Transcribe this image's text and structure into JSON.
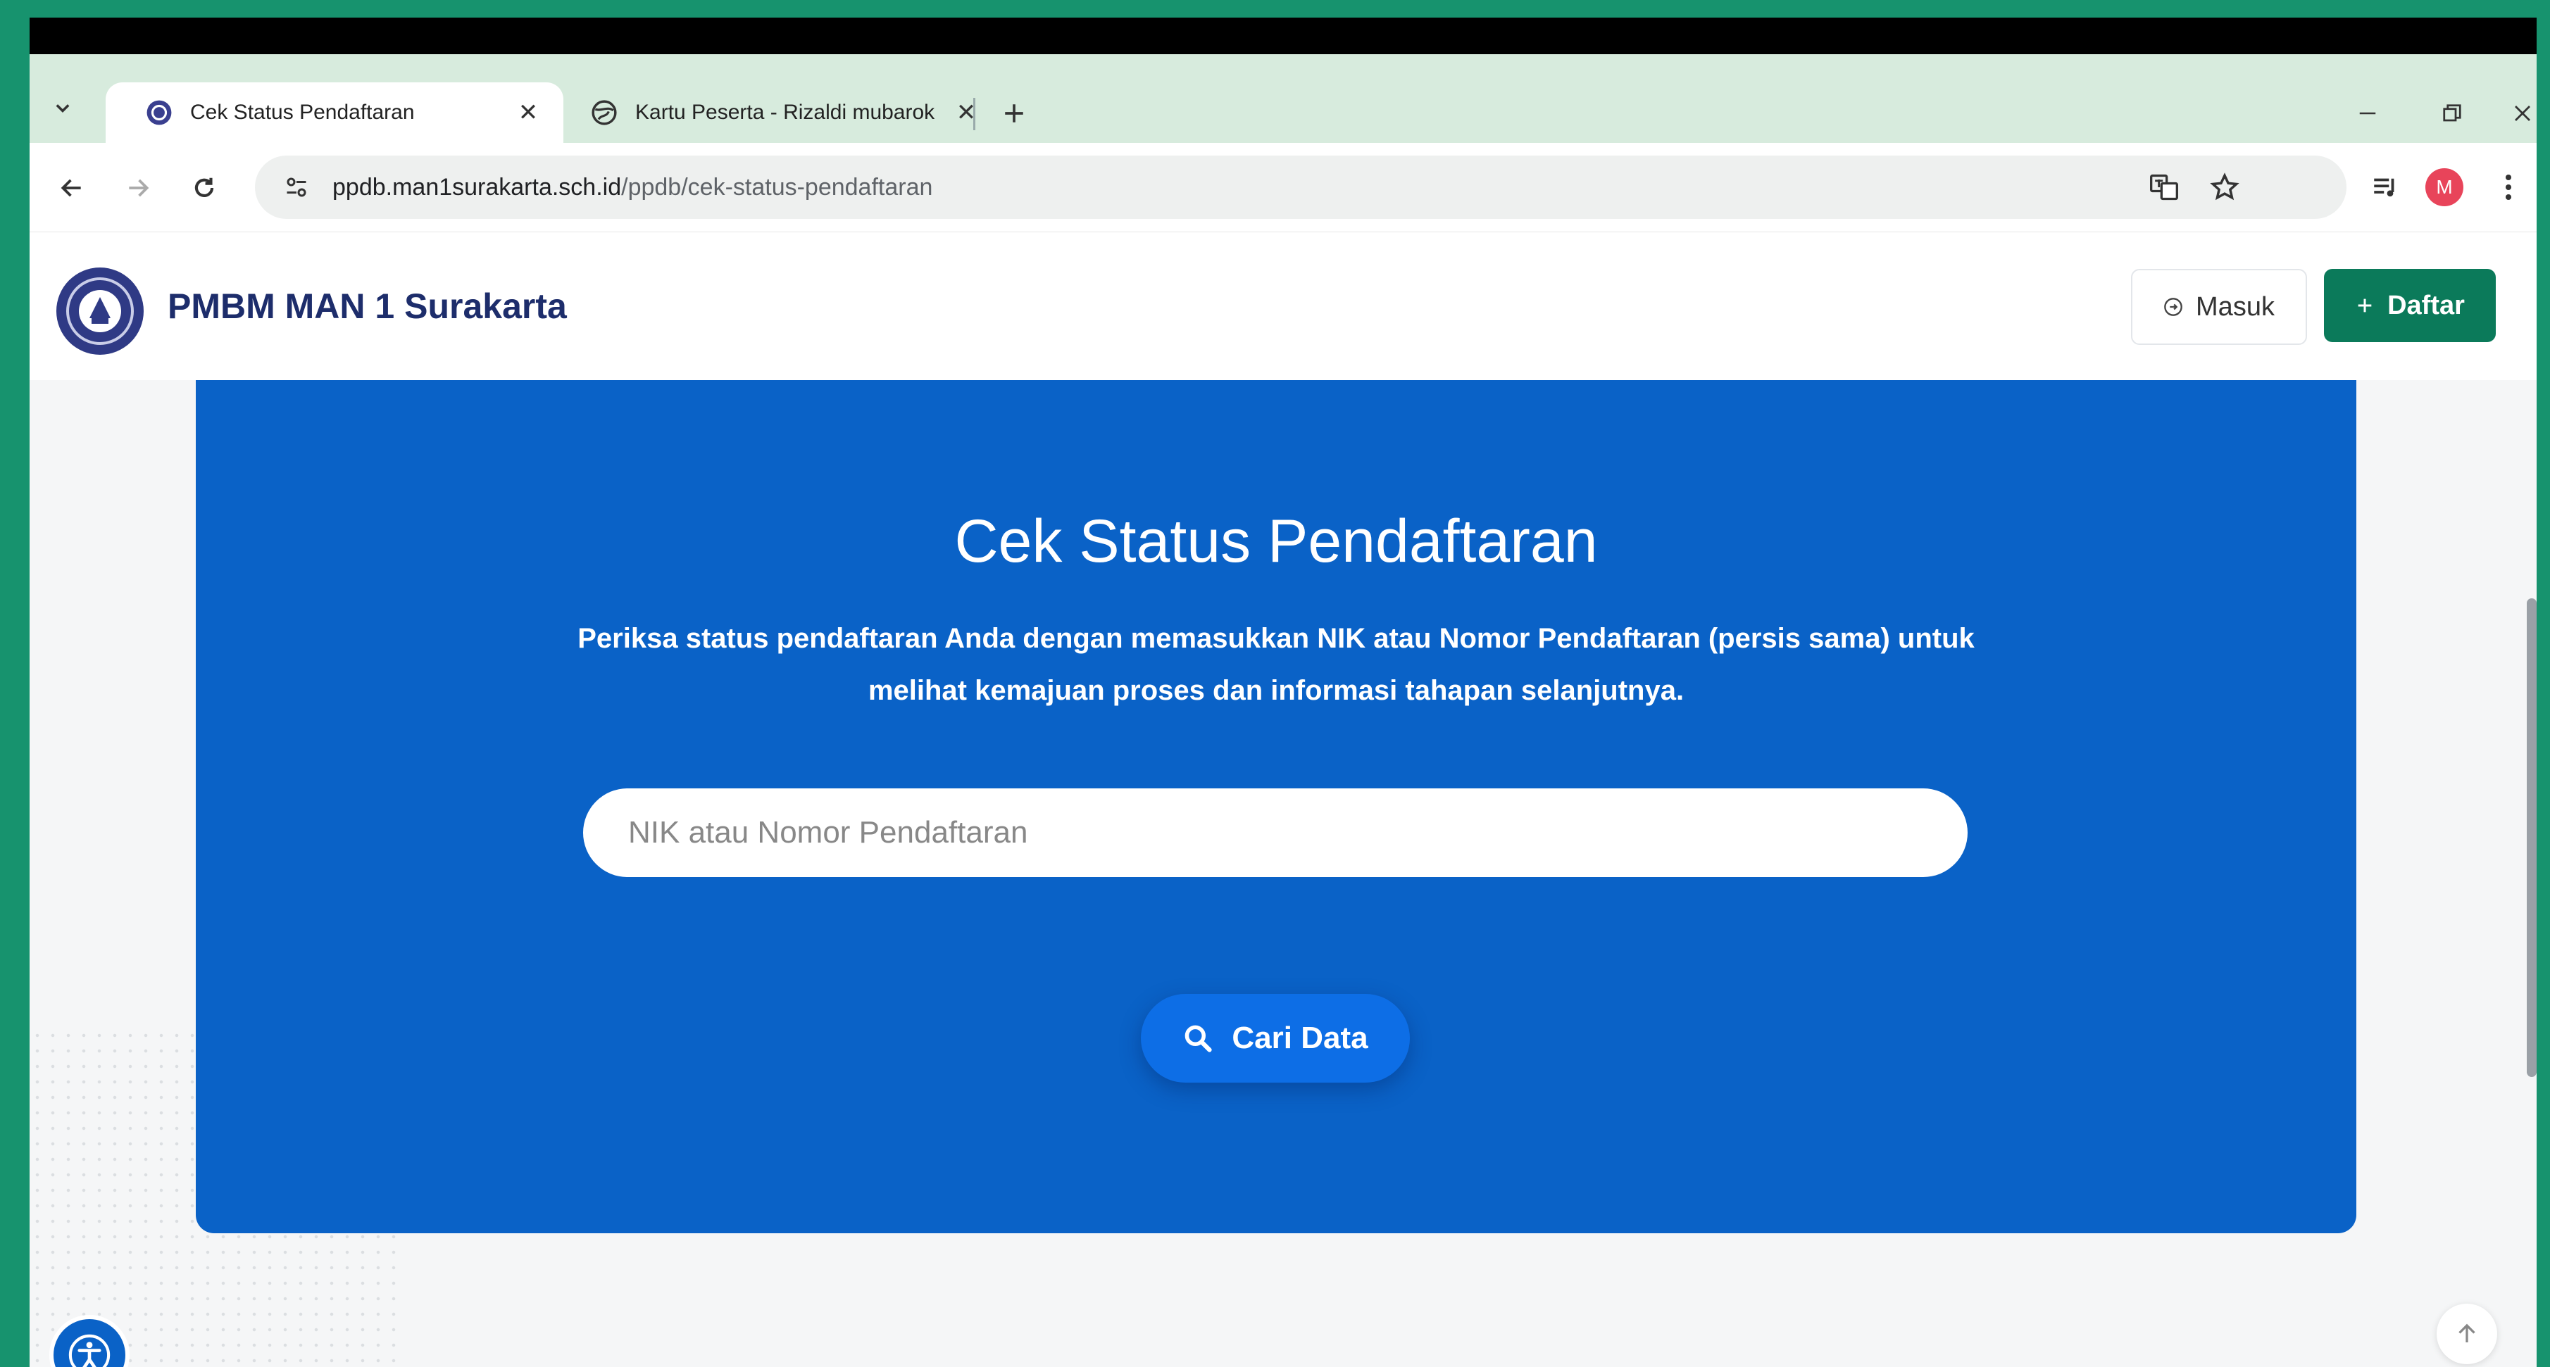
{
  "browser": {
    "tabs": [
      {
        "title": "Cek Status Pendaftaran",
        "favicon": "school-logo-icon",
        "active": true
      },
      {
        "title": "Kartu Peserta - Rizaldi mubarok",
        "favicon": "globe-icon",
        "active": false
      }
    ],
    "url": {
      "host": "ppdb.man1surakarta.sch.id",
      "path": "/ppdb/cek-status-pendaftaran"
    },
    "profile_initial": "M",
    "icons": {
      "tab_list": "chevron-down-icon",
      "new_tab": "plus-icon",
      "back": "arrow-left-icon",
      "forward": "arrow-right-icon",
      "reload": "reload-icon",
      "site_info": "tune-icon",
      "translate": "translate-icon",
      "bookmark": "star-icon",
      "media": "media-queue-icon",
      "menu": "kebab-menu-icon"
    }
  },
  "site": {
    "brand": "PMBM MAN 1 Surakarta",
    "login_label": "Masuk",
    "register_label": "Daftar"
  },
  "hero": {
    "title": "Cek Status Pendaftaran",
    "description": "Periksa status pendaftaran Anda dengan memasukkan NIK atau Nomor Pendaftaran (persis sama) untuk melihat kemajuan proses dan informasi tahapan selanjutnya.",
    "search_placeholder": "NIK atau Nomor Pendaftaran",
    "search_value": "",
    "search_button": "Cari Data"
  },
  "colors": {
    "hero_background": "#0a62c7",
    "primary_button": "#0b7a5a",
    "search_button": "#0d6ee6",
    "brand_text": "#1d2d6b",
    "frame_border": "#17936e"
  }
}
